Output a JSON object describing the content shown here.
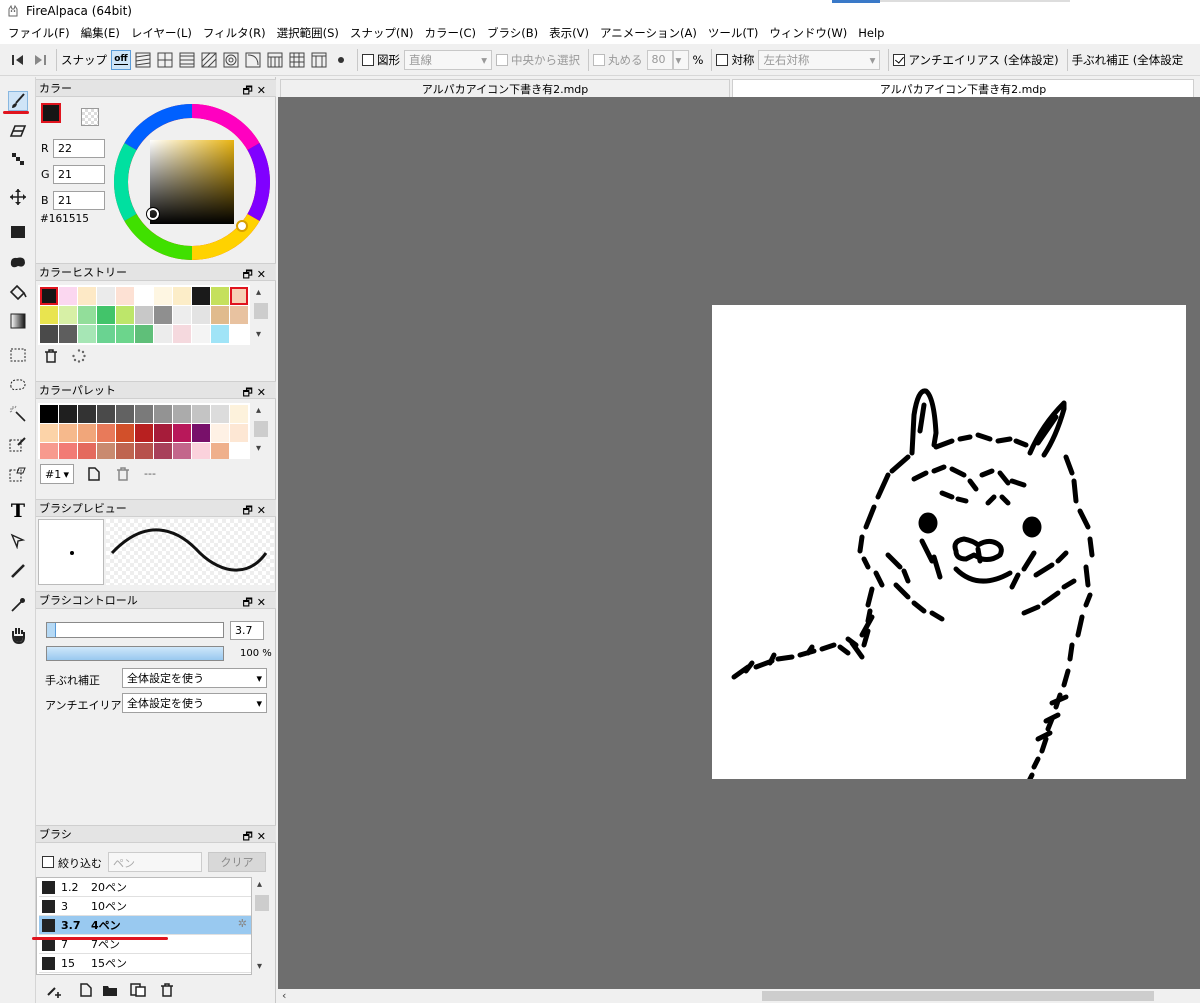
{
  "window": {
    "title": "FireAlpaca (64bit)"
  },
  "menu": [
    "ファイル(F)",
    "編集(E)",
    "レイヤー(L)",
    "フィルタ(R)",
    "選択範囲(S)",
    "スナップ(N)",
    "カラー(C)",
    "ブラシ(B)",
    "表示(V)",
    "アニメーション(A)",
    "ツール(T)",
    "ウィンドウ(W)",
    "Help"
  ],
  "toolbar": {
    "snap_label": "スナップ",
    "snap_off": "off",
    "shape_label": "図形",
    "shape_value": "直線",
    "center_select_label": "中央から選択",
    "round_label": "丸める",
    "round_value": "80",
    "percent": "%",
    "symmetry_label": "対称",
    "symmetry_value": "左右対称",
    "antialias_label": "アンチエイリアス (全体設定)",
    "stabilizer_label": "手ぶれ補正 (全体設定"
  },
  "color_panel": {
    "title": "カラー",
    "r_label": "R",
    "r_value": "22",
    "g_label": "G",
    "g_value": "21",
    "b_label": "B",
    "b_value": "21",
    "hex": "#161515",
    "fg_color": "#161515"
  },
  "color_history": {
    "title": "カラーヒストリー",
    "rows": [
      [
        "#161515",
        "#fbd7f0",
        "#fde9c6",
        "#ebebeb",
        "#fde1d4",
        "#ffffff",
        "#fef6e2",
        "#fcedc8",
        "#1a1a1a",
        "#c5e05c",
        "#f7d1b5"
      ],
      [
        "#e9e44f",
        "#d7f0a6",
        "#92de9a",
        "#42c46a",
        "#bde66a",
        "#c8c8c8",
        "#8f8f8f",
        "#ededed",
        "#e3e3e3",
        "#e0bb8d",
        "#e8c2a0"
      ],
      [
        "#4a4a4a",
        "#5e5e5e",
        "#a6e6b5",
        "#6ad391",
        "#6cd58c",
        "#5fbf79",
        "#ececec",
        "#f5d9de",
        "#f4f4f4",
        "#a0e4f7",
        "#ffffff"
      ]
    ]
  },
  "color_palette": {
    "title": "カラーパレット",
    "rows": [
      [
        "#000000",
        "#1f1f1f",
        "#333333",
        "#4a4a4a",
        "#626262",
        "#7a7a7a",
        "#939393",
        "#ababab",
        "#c4c4c4",
        "#dcdcdc",
        "#fdf2dc"
      ],
      [
        "#fcd3a8",
        "#f6b98c",
        "#f1a67a",
        "#e87a5a",
        "#d2502a",
        "#b82020",
        "#a61c3a",
        "#b8185a",
        "#78106a",
        "#fef1e5",
        "#fde7d4"
      ],
      [
        "#f79a8e",
        "#f27b75",
        "#e46a5d",
        "#c98a6f",
        "#bf6550",
        "#b7514c",
        "#a8405a",
        "#c3668b",
        "#fbd2dc",
        "#efb08c",
        "#ffffff"
      ]
    ],
    "palette_name": "#1",
    "dash": "---"
  },
  "brush_preview": {
    "title": "ブラシプレビュー"
  },
  "brush_control": {
    "title": "ブラシコントロール",
    "size_value": "3.7",
    "size_fraction": 0.05,
    "opacity_value": "100",
    "opacity_unit": "%",
    "opacity_fraction": 1.0,
    "stabilizer_label": "手ぶれ補正",
    "stabilizer_value": "全体設定を使う",
    "antialias_label": "アンチエイリアス",
    "antialias_value": "全体設定を使う"
  },
  "brush_panel": {
    "title": "ブラシ",
    "filter_label": "絞り込む",
    "filter_placeholder": "ペン",
    "clear_label": "クリア",
    "items": [
      {
        "size": "1.2",
        "name": "20ペン"
      },
      {
        "size": "3",
        "name": "10ペン"
      },
      {
        "size": "3.7",
        "name": "4ペン",
        "selected": true
      },
      {
        "size": "7",
        "name": "7ペン"
      },
      {
        "size": "15",
        "name": "15ペン"
      }
    ]
  },
  "tabs": [
    {
      "label": "アルパカアイコン下書き有2.mdp"
    },
    {
      "label": "アルパカアイコン下書き有2.mdp",
      "active": true
    }
  ],
  "accent": "#e0141e"
}
